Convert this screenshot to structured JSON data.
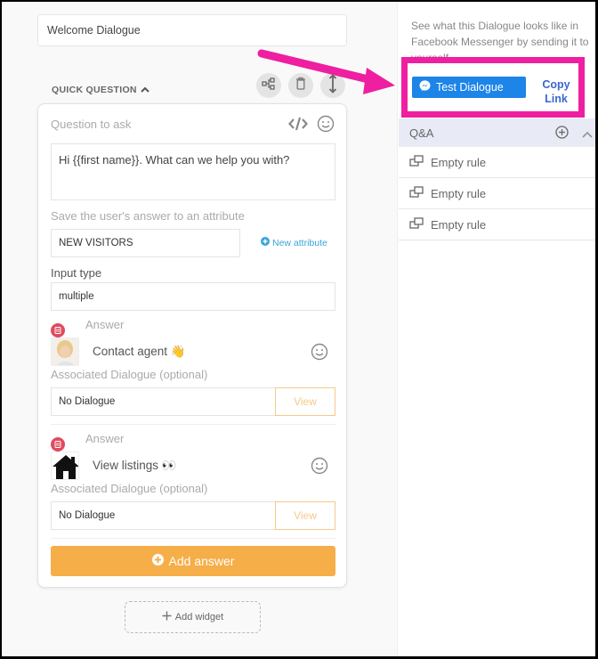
{
  "editor": {
    "dialogue_name": "Welcome Dialogue",
    "section_title": "QUICK QUESTION",
    "tool_icons": [
      "flow-icon",
      "trash-icon",
      "reorder-icon"
    ],
    "question_label": "Question to ask",
    "question_text": "Hi {{first name}}. What can we help you with?",
    "attribute_label": "Save the user's answer to an attribute",
    "attribute_value": "NEW VISITORS",
    "new_attribute_link": "New attribute",
    "input_type_label": "Input type",
    "input_type_value": "multiple",
    "answers": [
      {
        "label": "Answer",
        "text": "Contact agent 👋",
        "thumbnail": "agent-photo",
        "associated_label": "Associated Dialogue (optional)",
        "associated_value": "No Dialogue",
        "view_label": "View"
      },
      {
        "label": "Answer",
        "text": "View listings 👀",
        "thumbnail": "house-icon",
        "associated_label": "Associated Dialogue (optional)",
        "associated_value": "No Dialogue",
        "view_label": "View"
      }
    ],
    "add_answer_label": "Add answer",
    "add_widget_label": "Add widget"
  },
  "right_panel": {
    "description": "See what this Dialogue looks like in Facebook Messenger by sending it to yourself.",
    "test_button_label": "Test Dialogue",
    "copy_link_label": "Copy Link",
    "qa_title": "Q&A",
    "rules": [
      "Empty rule",
      "Empty rule",
      "Empty rule"
    ]
  },
  "colors": {
    "accent_orange": "#f6ae48",
    "messenger_blue": "#1d84e8",
    "annotation_pink": "#ee1fa0",
    "danger_red": "#e04b5e",
    "link_blue": "#3a66d0"
  }
}
